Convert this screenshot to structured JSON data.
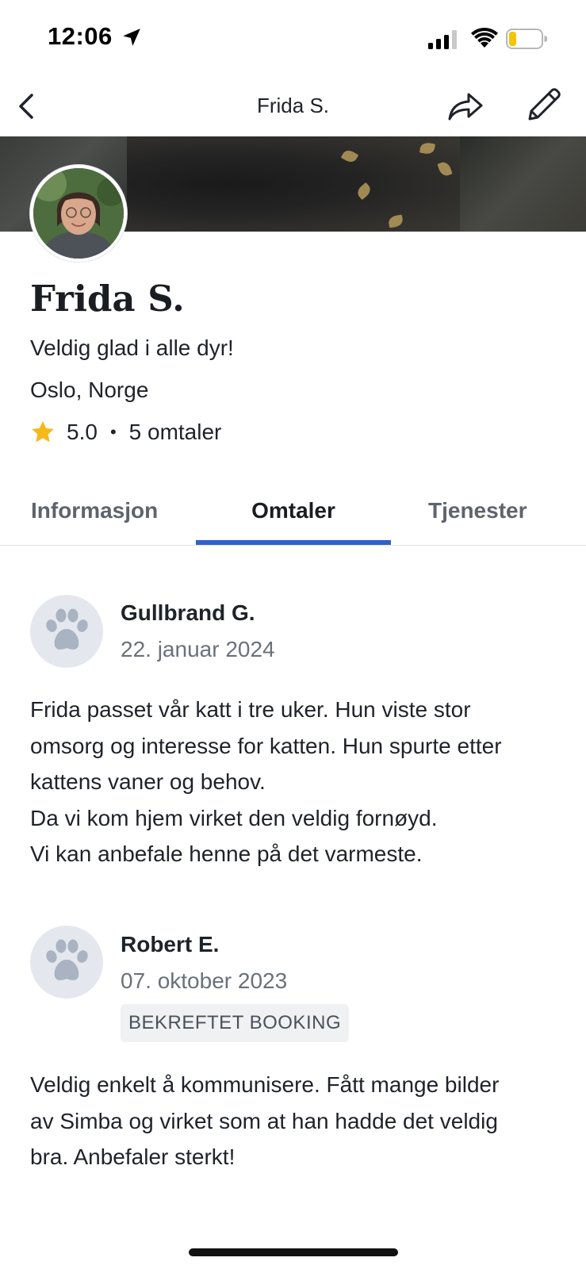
{
  "status_bar": {
    "time": "12:06",
    "location_icon": "location-arrow-icon",
    "signal_icon": "cellular-signal-icon",
    "wifi_icon": "wifi-icon",
    "battery_icon": "battery-low-icon",
    "battery_color": "#f5c400"
  },
  "nav": {
    "title": "Frida S.",
    "back_icon": "chevron-left-icon",
    "share_icon": "share-arrow-icon",
    "edit_icon": "pencil-icon"
  },
  "profile": {
    "name": "Frida S.",
    "bio": "Veldig glad i alle dyr!",
    "location": "Oslo, Norge",
    "rating": "5.0",
    "separator": "•",
    "review_count": "5 omtaler",
    "star_color": "#f6b91c"
  },
  "tabs": [
    {
      "label": "Informasjon",
      "active": false
    },
    {
      "label": "Omtaler",
      "active": true
    },
    {
      "label": "Tjenester",
      "active": false
    }
  ],
  "accent_color": "#2f61c9",
  "reviews": [
    {
      "name": "Gullbrand G.",
      "date": "22. januar 2024",
      "text": "Frida passet vår katt i tre uker. Hun viste stor\nomsorg og interesse for katten. Hun spurte etter\nkattens vaner og behov.\nDa vi kom hjem virket den veldig fornøyd.\nVi kan anbefale henne på det varmeste."
    },
    {
      "name": "Robert E.",
      "date": "07. oktober 2023",
      "badge": "BEKREFTET BOOKING",
      "text": "Veldig enkelt å kommunisere. Fått mange bilder\nav Simba og virket som at han hadde det veldig\nbra. Anbefaler sterkt!"
    }
  ]
}
